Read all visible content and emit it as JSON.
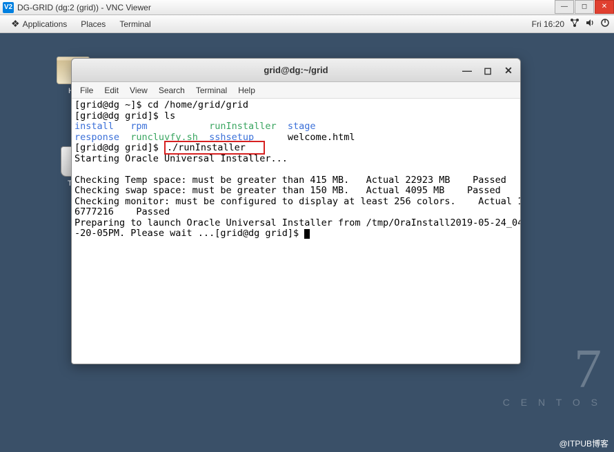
{
  "vnc": {
    "title": "DG-GRID (dg:2 (grid)) - VNC Viewer",
    "icon_text": "V2"
  },
  "gnome": {
    "applications": "Applications",
    "places": "Places",
    "terminal": "Terminal",
    "time": "Fri 16:20"
  },
  "desktop_icons": {
    "home": "Ho",
    "trash": "Tra"
  },
  "centos": {
    "seven": "7",
    "name": "C E N T O S"
  },
  "watermark": "@ITPUB博客",
  "terminal_window": {
    "title": "grid@dg:~/grid",
    "menu": {
      "file": "File",
      "edit": "Edit",
      "view": "View",
      "search": "Search",
      "terminal": "Terminal",
      "help": "Help"
    },
    "lines": {
      "l1_prompt": "[grid@dg ~]$ ",
      "l1_cmd": "cd /home/grid/grid",
      "l2_prompt": "[grid@dg grid]$ ",
      "l2_cmd": "ls",
      "l3_install": "install",
      "l3_rpm": "rpm",
      "l3_runinst": "runInstaller",
      "l3_stage": "stage",
      "l4_response": "response",
      "l4_runcluvfy": "runcluvfy.sh",
      "l4_sshsetup": "sshsetup",
      "l4_welcome": "welcome.html",
      "l5_prompt": "[grid@dg grid]$ ",
      "l5_cmd": "./runInstaller   ",
      "l6": "Starting Oracle Universal Installer...",
      "l7": "",
      "l8": "Checking Temp space: must be greater than 415 MB.   Actual 22923 MB    Passed",
      "l9": "Checking swap space: must be greater than 150 MB.   Actual 4095 MB    Passed",
      "l10": "Checking monitor: must be configured to display at least 256 colors.    Actual 1",
      "l11": "6777216    Passed",
      "l12": "Preparing to launch Oracle Universal Installer from /tmp/OraInstall2019-05-24_04",
      "l13_a": "-20-05PM. Please wait ...",
      "l13_b": "[grid@dg grid]$ "
    }
  }
}
